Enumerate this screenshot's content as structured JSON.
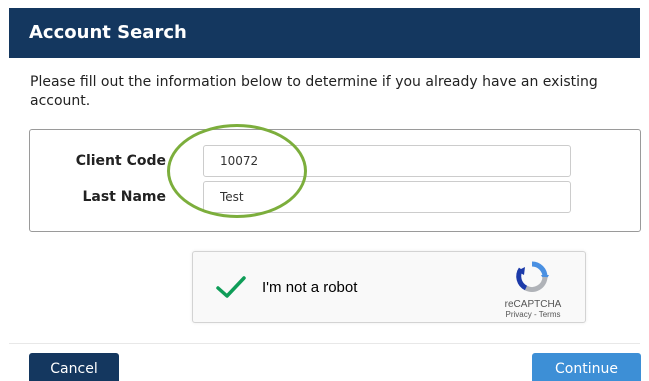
{
  "header": {
    "title": "Account Search"
  },
  "intro": {
    "text": "Please fill out the information below to determine if you already have an existing account."
  },
  "form": {
    "client_code": {
      "label": "Client Code",
      "value": "10072"
    },
    "last_name": {
      "label": "Last Name",
      "value": "Test"
    }
  },
  "captcha": {
    "label": "I'm not a robot",
    "checked": true,
    "brand": "reCAPTCHA",
    "links": "Privacy - Terms",
    "check_icon": "checkmark-icon",
    "logo_icon": "recaptcha-logo-icon"
  },
  "buttons": {
    "cancel": "Cancel",
    "continue": "Continue"
  },
  "colors": {
    "header_bg": "#14375f",
    "cancel_bg": "#14375f",
    "continue_bg": "#3d8fd6",
    "checkmark": "#0f9d58",
    "annotation": "#7cae3c"
  }
}
